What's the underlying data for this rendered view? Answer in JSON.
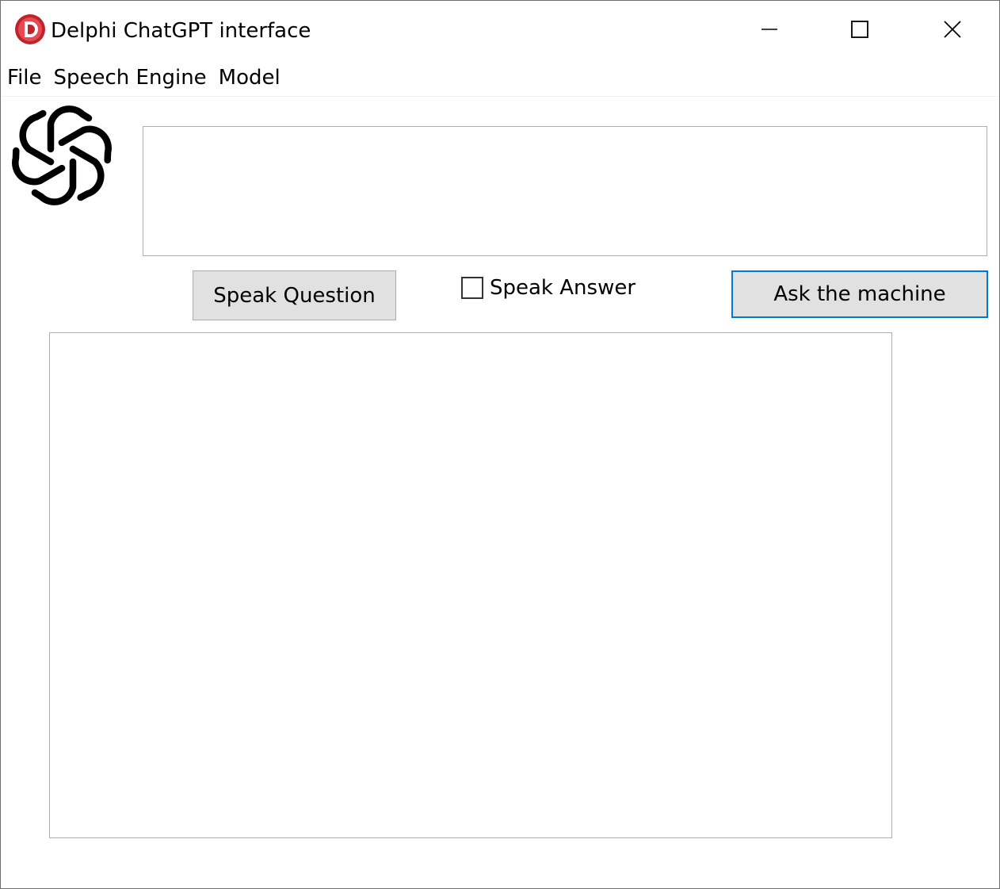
{
  "window": {
    "title": "Delphi ChatGPT interface",
    "app_icon": "delphi-logo-icon",
    "controls": [
      "minimize-icon",
      "maximize-icon",
      "close-icon"
    ]
  },
  "menubar": {
    "items": [
      {
        "label": "File"
      },
      {
        "label": "Speech Engine"
      },
      {
        "label": "Model"
      }
    ]
  },
  "logo": {
    "icon": "openai-logo-icon"
  },
  "question": {
    "value": "",
    "placeholder": ""
  },
  "controls": {
    "speak_question_label": "Speak Question",
    "speak_answer_label": "Speak Answer",
    "speak_answer_checked": false,
    "ask_label": "Ask the machine"
  },
  "answer": {
    "value": ""
  },
  "colors": {
    "accent": "#0078d7",
    "button_face": "#e1e1e1",
    "border": "#adadad",
    "delphi_red": "#c0232c"
  }
}
